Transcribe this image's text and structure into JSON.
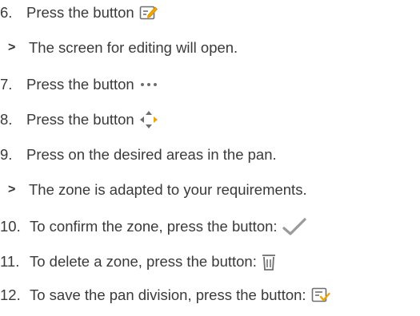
{
  "steps": [
    {
      "num": "6.",
      "text": "Press the button",
      "icon": "edit-icon"
    },
    {
      "marker": ">",
      "text": "The screen for editing will open."
    },
    {
      "num": "7.",
      "text": "Press the button",
      "icon": "more-dots-icon"
    },
    {
      "num": "8.",
      "text": "Press the button",
      "icon": "move-arrows-icon"
    },
    {
      "num": "9.",
      "text": "Press on the desired areas in the pan."
    },
    {
      "marker": ">",
      "text": "The zone is adapted to your requirements."
    },
    {
      "num": "10.",
      "text": "To confirm the zone, press the button:",
      "icon": "checkmark-icon"
    },
    {
      "num": "11.",
      "text": "To delete a zone, press the button:",
      "icon": "trash-icon"
    },
    {
      "num": "12.",
      "text": "To save the pan division, press the button:",
      "icon": "save-division-icon"
    }
  ],
  "colors": {
    "text": "#3a3a3a",
    "icon": "#6f6f6f",
    "accent": "#f0a500",
    "confirm": "#9a9a9a"
  }
}
